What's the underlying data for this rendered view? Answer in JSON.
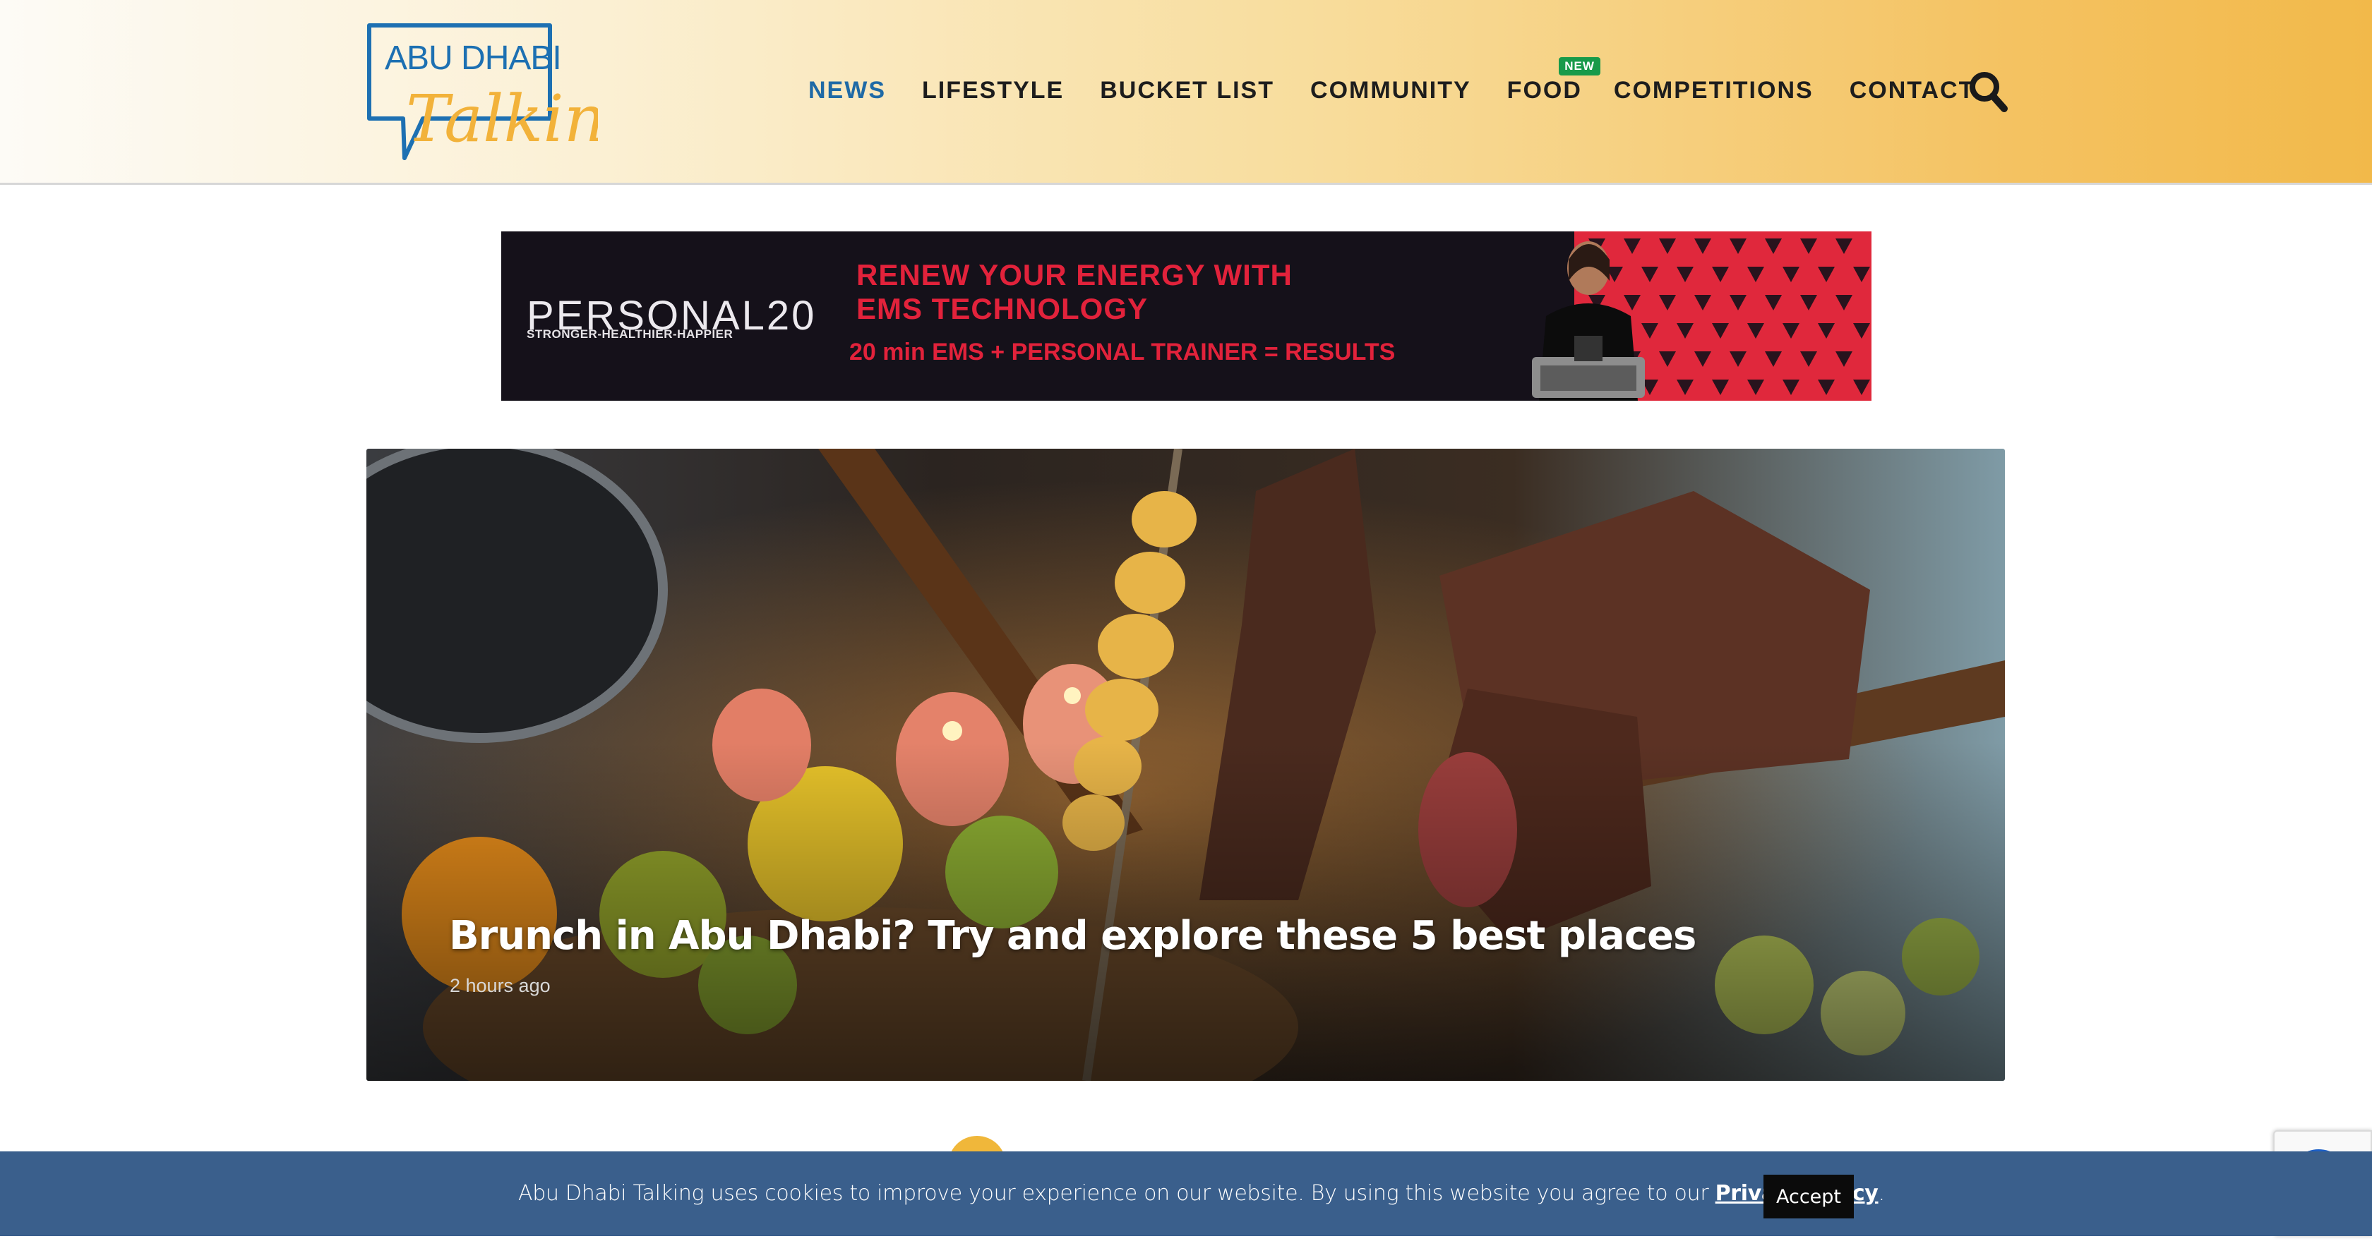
{
  "header": {
    "logo": {
      "line1": "ABU DHABI",
      "line2": "Talking"
    },
    "nav": [
      {
        "label": "NEWS",
        "active": true
      },
      {
        "label": "LIFESTYLE"
      },
      {
        "label": "BUCKET LIST"
      },
      {
        "label": "COMMUNITY"
      },
      {
        "label": "FOOD",
        "badge": "NEW"
      },
      {
        "label": "COMPETITIONS"
      },
      {
        "label": "CONTACT"
      }
    ],
    "search_icon": "search-icon"
  },
  "ad": {
    "brand": "PERSONAL20",
    "tagline": "STRONGER-HEALTHIER-HAPPIER",
    "headline_line1": "RENEW YOUR ENERGY WITH",
    "headline_line2": "EMS TECHNOLOGY",
    "subline": "20 min EMS + PERSONAL TRAINER = RESULTS",
    "accent_color": "#e2223b"
  },
  "hero": {
    "title": "Brunch in Abu Dhabi? Try and explore these 5 best places",
    "time": "2 hours ago"
  },
  "cookie": {
    "text": "Abu Dhabi Talking uses cookies to improve your experience on our website. By using this website you agree to our ",
    "link": "Privacy Policy",
    "suffix": ".",
    "accept": "Accept"
  },
  "colors": {
    "nav_active": "#1f6aa6",
    "header_gradient_end": "#f2b94a",
    "cookie_bar": "#3a5f8c"
  }
}
